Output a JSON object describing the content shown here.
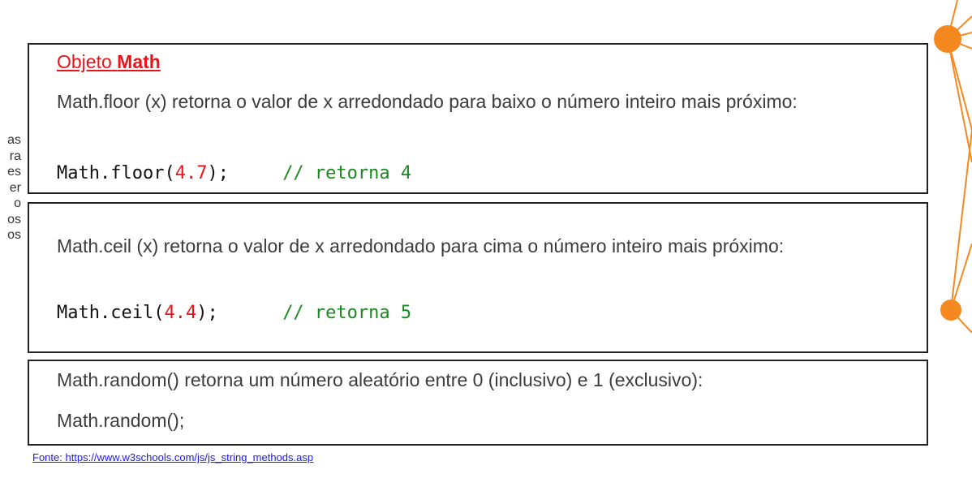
{
  "side_fragment": [
    "as",
    "ra",
    "es",
    "er",
    "o",
    "os",
    "os"
  ],
  "box1": {
    "heading_prefix": "Objeto",
    "heading_bold": "Math",
    "description": "Math.floor (x) retorna o valor de x arredondado para baixo o número inteiro mais próximo:",
    "code_fn": "Math.floor(",
    "code_arg": "4.7",
    "code_end": ");",
    "code_comment": "// retorna 4"
  },
  "box2": {
    "description": "Math.ceil (x) retorna o valor de x arredondado para cima o número inteiro mais próximo:",
    "code_fn": "Math.ceil(",
    "code_arg": "4.4",
    "code_end": ");",
    "code_comment": "// retorna 5"
  },
  "box3": {
    "description": "Math.random() retorna um número aleatório entre 0 (inclusivo) e 1 (exclusivo):",
    "code": "Math.random();"
  },
  "source_link": "Fonte: https://www.w3schools.com/js/js_string_methods.asp",
  "colors": {
    "accent_orange": "#f5891f",
    "heading_red": "#e8141a",
    "comment_green": "#188a1e",
    "link_blue": "#1a1aee"
  }
}
